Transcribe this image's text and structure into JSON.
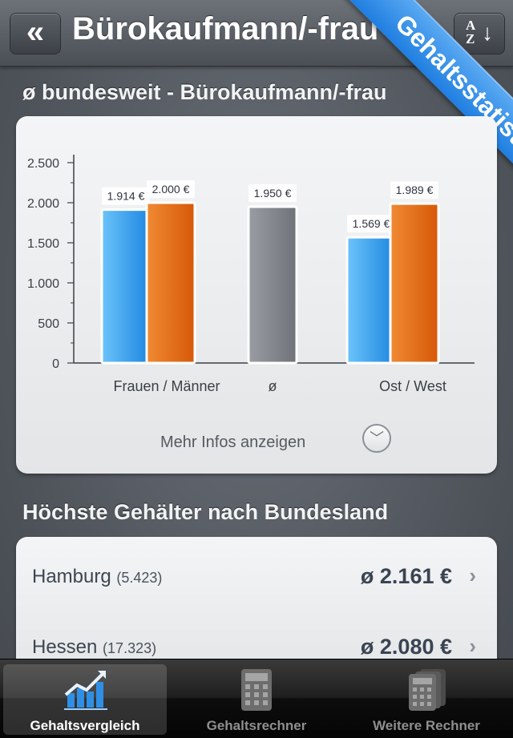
{
  "header": {
    "title": "Bürokaufmann/-frau",
    "back_label": "«",
    "sort_icon": "sort-az-icon"
  },
  "ribbon": {
    "label": "Gehaltsstatistik",
    "color": "#2b8be8"
  },
  "chart_section": {
    "heading": "ø bundesweit - Bürokaufmann/-frau",
    "more_label": "Mehr Infos anzeigen"
  },
  "chart_data": {
    "type": "bar",
    "categories": [
      "Frauen / Männer",
      "ø",
      "Ost / West"
    ],
    "series": [
      {
        "name": "Frauen",
        "color": "#2fa3f2",
        "values": [
          1914,
          null,
          null
        ]
      },
      {
        "name": "Männer",
        "color": "#e36a12",
        "values": [
          2000,
          null,
          null
        ]
      },
      {
        "name": "ø",
        "color": "#8a8d93",
        "values": [
          null,
          1950,
          null
        ]
      },
      {
        "name": "Ost",
        "color": "#2fa3f2",
        "values": [
          null,
          null,
          1569
        ]
      },
      {
        "name": "West",
        "color": "#e36a12",
        "values": [
          null,
          null,
          1989
        ]
      }
    ],
    "bars": [
      {
        "category": "Frauen / Männer",
        "series": "Frauen",
        "value": 1914,
        "label": "1.914 €"
      },
      {
        "category": "Frauen / Männer",
        "series": "Männer",
        "value": 2000,
        "label": "2.000 €"
      },
      {
        "category": "ø",
        "series": "ø",
        "value": 1950,
        "label": "1.950 €"
      },
      {
        "category": "Ost / West",
        "series": "Ost",
        "value": 1569,
        "label": "1.569 €"
      },
      {
        "category": "Ost / West",
        "series": "West",
        "value": 1989,
        "label": "1.989 €"
      }
    ],
    "yticks": [
      "0",
      "500",
      "1.000",
      "1.500",
      "2.000",
      "2.500"
    ],
    "ytick_values": [
      0,
      500,
      1000,
      1500,
      2000,
      2500
    ],
    "ylim": [
      0,
      2500
    ],
    "grid": false,
    "unit": "€"
  },
  "states_section": {
    "heading": "Höchste Gehälter nach Bundesland",
    "rows": [
      {
        "state": "Hamburg",
        "count": "(5.423)",
        "value": "ø 2.161 €"
      },
      {
        "state": "Hessen",
        "count": "(17.323)",
        "value": "ø 2.080 €"
      }
    ]
  },
  "tabbar": {
    "tabs": [
      {
        "label": "Gehaltsvergleich",
        "icon": "chart-trend-icon",
        "active": true
      },
      {
        "label": "Gehaltsrechner",
        "icon": "calculator-icon",
        "active": false
      },
      {
        "label": "Weitere Rechner",
        "icon": "calculators-stack-icon",
        "active": false
      }
    ]
  }
}
